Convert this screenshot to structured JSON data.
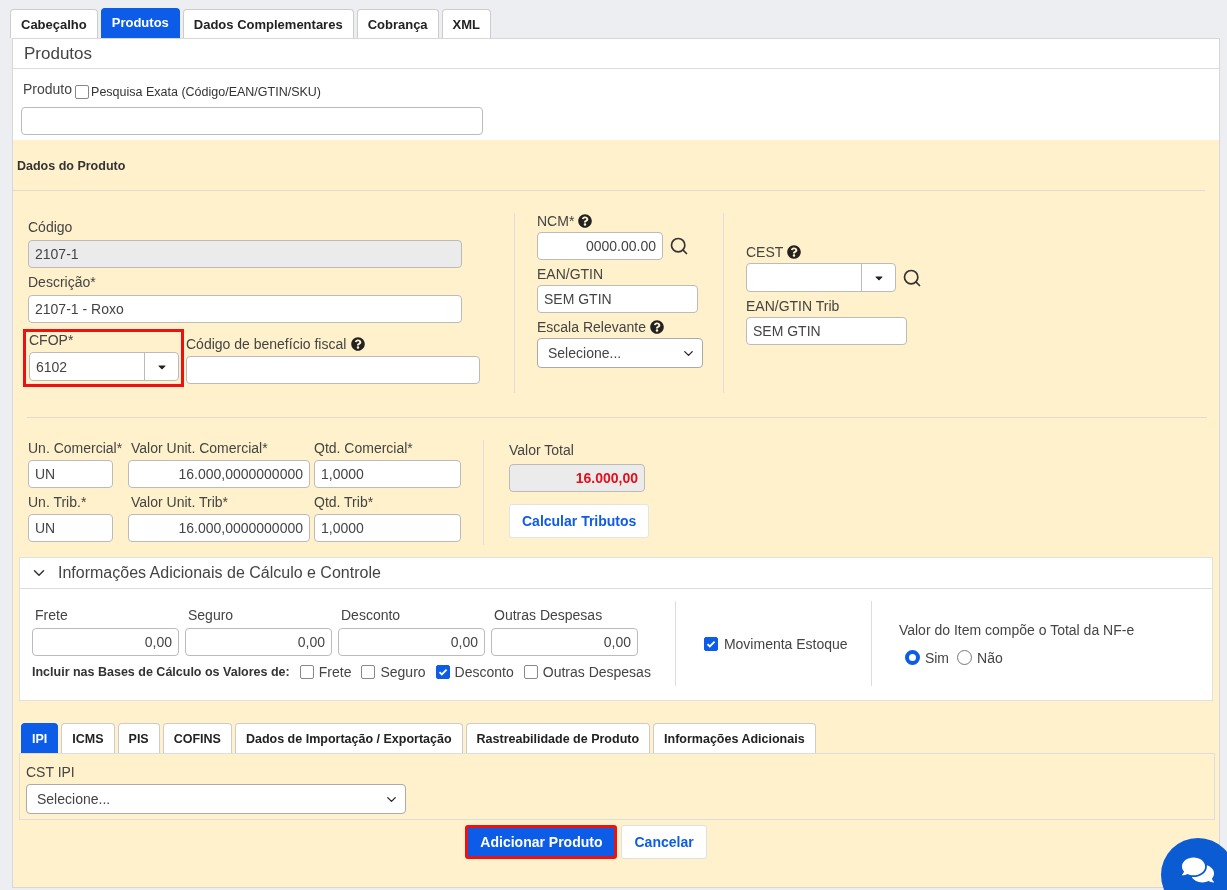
{
  "tabs": [
    {
      "label": "Cabeçalho",
      "selected": false
    },
    {
      "label": "Produtos",
      "selected": true
    },
    {
      "label": "Dados Complementares",
      "selected": false
    },
    {
      "label": "Cobrança",
      "selected": false
    },
    {
      "label": "XML",
      "selected": false
    }
  ],
  "panel": {
    "title": "Produtos"
  },
  "search": {
    "label": "Produto",
    "exact": {
      "label": "Pesquisa Exata (Código/EAN/GTIN/SKU)",
      "checked": false
    }
  },
  "product": {
    "title": "Dados do Produto",
    "codigo": {
      "label": "Código",
      "value": "2107-1",
      "disabled": true
    },
    "descricao": {
      "label": "Descrição*",
      "value": "2107-1 - Roxo",
      "disabled": false
    },
    "cfop": {
      "label": "CFOP*",
      "value": "6102",
      "highlighted": true
    },
    "beneficio": {
      "label": "Código de benefício fiscal"
    },
    "ncm": {
      "label": "NCM*",
      "value": "0000.00.00"
    },
    "ean": {
      "label": "EAN/GTIN",
      "value": "SEM GTIN"
    },
    "escala": {
      "label": "Escala Relevante",
      "value": "Selecione..."
    },
    "cest": {
      "label": "CEST"
    },
    "ean_trib": {
      "label": "EAN/GTIN Trib",
      "value": "SEM GTIN"
    }
  },
  "quantities": {
    "rows": [
      {
        "unit": {
          "label": "Un. Comercial*",
          "value": "UN"
        },
        "price": {
          "label": "Valor Unit. Comercial*",
          "value": "16.000,0000000000"
        },
        "qty": {
          "label": "Qtd. Comercial*",
          "value": "1,0000"
        }
      },
      {
        "unit": {
          "label": "Un. Trib.*",
          "value": "UN"
        },
        "price": {
          "label": "Valor Unit. Trib*",
          "value": "16.000,0000000000"
        },
        "qty": {
          "label": "Qtd. Trib*",
          "value": "1,0000"
        }
      }
    ],
    "total": {
      "label": "Valor Total",
      "value": "16.000,00"
    },
    "calc_button": "Calcular Tributos"
  },
  "additional": {
    "title": "Informações Adicionais de Cálculo e Controle",
    "expanded": true,
    "costs": [
      {
        "label": "Frete",
        "value": "0,00"
      },
      {
        "label": "Seguro",
        "value": "0,00"
      },
      {
        "label": "Desconto",
        "value": "0,00"
      },
      {
        "label": "Outras Despesas",
        "value": "0,00"
      }
    ],
    "include_label": "Incluir nas Bases de Cálculo os Valores de:",
    "include": [
      {
        "label": "Frete",
        "checked": false
      },
      {
        "label": "Seguro",
        "checked": false
      },
      {
        "label": "Desconto",
        "checked": true
      },
      {
        "label": "Outras Despesas",
        "checked": false
      }
    ],
    "stock": {
      "label": "Movimenta Estoque",
      "checked": true
    },
    "compose": {
      "label": "Valor do Item compõe o Total da NF-e",
      "options": [
        {
          "label": "Sim",
          "selected": true
        },
        {
          "label": "Não",
          "selected": false
        }
      ]
    }
  },
  "tax_tabs": [
    {
      "label": "IPI",
      "selected": true
    },
    {
      "label": "ICMS",
      "selected": false
    },
    {
      "label": "PIS",
      "selected": false
    },
    {
      "label": "COFINS",
      "selected": false
    },
    {
      "label": "Dados de Importação / Exportação",
      "selected": false
    },
    {
      "label": "Rastreabilidade de Produto",
      "selected": false
    },
    {
      "label": "Informações Adicionais",
      "selected": false
    }
  ],
  "cst": {
    "label": "CST IPI",
    "value": "Selecione..."
  },
  "buttons": [
    {
      "label": "Adicionar Produto",
      "kind": "primary",
      "highlighted": true
    },
    {
      "label": "Cancelar",
      "kind": "secondary",
      "highlighted": false
    }
  ]
}
